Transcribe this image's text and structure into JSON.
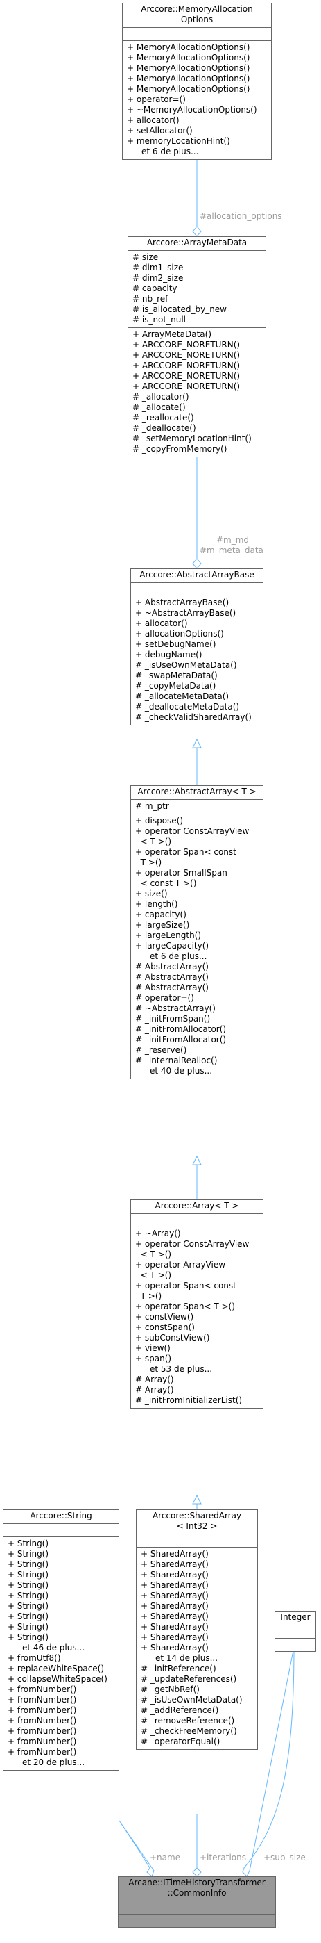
{
  "colors": {
    "edge": "#63b8ff",
    "border": "#666666",
    "label": "#9a9a9a",
    "focus_fill": "#999999"
  },
  "classes": [
    {
      "id": "mem",
      "title_lines": [
        "Arccore::MemoryAllocation",
        "Options"
      ],
      "sections": [
        [],
        [
          "+ MemoryAllocationOptions()",
          "+ MemoryAllocationOptions()",
          "+ MemoryAllocationOptions()",
          "+ MemoryAllocationOptions()",
          "+ MemoryAllocationOptions()",
          "+ operator=()",
          "+ ~MemoryAllocationOptions()",
          "+ allocator()",
          "+ setAllocator()",
          "+ memoryLocationHint()",
          "et 6 de plus..."
        ]
      ]
    },
    {
      "id": "meta",
      "title_lines": [
        "Arccore::ArrayMetaData"
      ],
      "sections": [
        [
          "# size",
          "# dim1_size",
          "# dim2_size",
          "# capacity",
          "# nb_ref",
          "# is_allocated_by_new",
          "# is_not_null"
        ],
        [
          "+ ArrayMetaData()",
          "+ ARCCORE_NORETURN()",
          "+ ARCCORE_NORETURN()",
          "+ ARCCORE_NORETURN()",
          "+ ARCCORE_NORETURN()",
          "+ ARCCORE_NORETURN()",
          "# _allocator()",
          "# _allocate()",
          "# _reallocate()",
          "# _deallocate()",
          "# _setMemoryLocationHint()",
          "# _copyFromMemory()"
        ]
      ]
    },
    {
      "id": "base",
      "title_lines": [
        "Arccore::AbstractArrayBase"
      ],
      "sections": [
        [],
        [
          "+ AbstractArrayBase()",
          "+ ~AbstractArrayBase()",
          "+ allocator()",
          "+ allocationOptions()",
          "+ setDebugName()",
          "+ debugName()",
          "# _isUseOwnMetaData()",
          "# _swapMetaData()",
          "# _copyMetaData()",
          "# _allocateMetaData()",
          "# _deallocateMetaData()",
          "# _checkValidSharedArray()"
        ]
      ]
    },
    {
      "id": "abs",
      "title_lines": [
        "Arccore::AbstractArray< T >"
      ],
      "sections": [
        [
          "# m_ptr"
        ],
        [
          "+ dispose()",
          "+ operator ConstArrayView",
          "  < T >()",
          "+ operator Span< const",
          "  T >()",
          "+ operator SmallSpan",
          "  < const T >()",
          "+ size()",
          "+ length()",
          "+ capacity()",
          "+ largeSize()",
          "+ largeLength()",
          "+ largeCapacity()",
          "et 6 de plus...",
          "# AbstractArray()",
          "# AbstractArray()",
          "# AbstractArray()",
          "# operator=()",
          "# ~AbstractArray()",
          "# _initFromSpan()",
          "# _initFromAllocator()",
          "# _initFromAllocator()",
          "# _reserve()",
          "# _internalRealloc()",
          "et 40 de plus..."
        ]
      ]
    },
    {
      "id": "arr",
      "title_lines": [
        "Arccore::Array< T >"
      ],
      "sections": [
        [],
        [
          "+ ~Array()",
          "+ operator ConstArrayView",
          "  < T >()",
          "+ operator ArrayView",
          "  < T >()",
          "+ operator Span< const",
          "  T >()",
          "+ operator Span< T >()",
          "+ constView()",
          "+ constSpan()",
          "+ subConstView()",
          "+ view()",
          "+ span()",
          "et 53 de plus...",
          "# Array()",
          "# Array()",
          "# _initFromInitializerList()"
        ]
      ]
    },
    {
      "id": "str",
      "title_lines": [
        "Arccore::String"
      ],
      "sections": [
        [],
        [
          "+ String()",
          "+ String()",
          "+ String()",
          "+ String()",
          "+ String()",
          "+ String()",
          "+ String()",
          "+ String()",
          "+ String()",
          "+ String()",
          "et 46 de plus...",
          "+ fromUtf8()",
          "+ replaceWhiteSpace()",
          "+ collapseWhiteSpace()",
          "+ fromNumber()",
          "+ fromNumber()",
          "+ fromNumber()",
          "+ fromNumber()",
          "+ fromNumber()",
          "+ fromNumber()",
          "+ fromNumber()",
          "et 20 de plus..."
        ]
      ]
    },
    {
      "id": "shared",
      "title_lines": [
        "Arccore::SharedArray",
        "< Int32 >"
      ],
      "sections": [
        [],
        [
          "+ SharedArray()",
          "+ SharedArray()",
          "+ SharedArray()",
          "+ SharedArray()",
          "+ SharedArray()",
          "+ SharedArray()",
          "+ SharedArray()",
          "+ SharedArray()",
          "+ SharedArray()",
          "+ SharedArray()",
          "et 14 de plus...",
          "# _initReference()",
          "# _updateReferences()",
          "# _getNbRef()",
          "# _isUseOwnMetaData()",
          "# _addReference()",
          "# _removeReference()",
          "# _checkFreeMemory()",
          "# _operatorEqual()"
        ]
      ]
    },
    {
      "id": "int",
      "title_lines": [
        "Integer"
      ],
      "sections": [
        [],
        []
      ]
    },
    {
      "id": "focus",
      "title_lines": [
        "Arcane::ITimeHistoryTransformer",
        "::CommonInfo"
      ],
      "sections": [
        [],
        []
      ]
    }
  ],
  "edge_labels": {
    "allocation_options": "#allocation_options",
    "m_md": "#m_md",
    "m_meta_data": "#m_meta_data",
    "name": "+name",
    "iterations": "+iterations",
    "sub_size": "+sub_size"
  }
}
